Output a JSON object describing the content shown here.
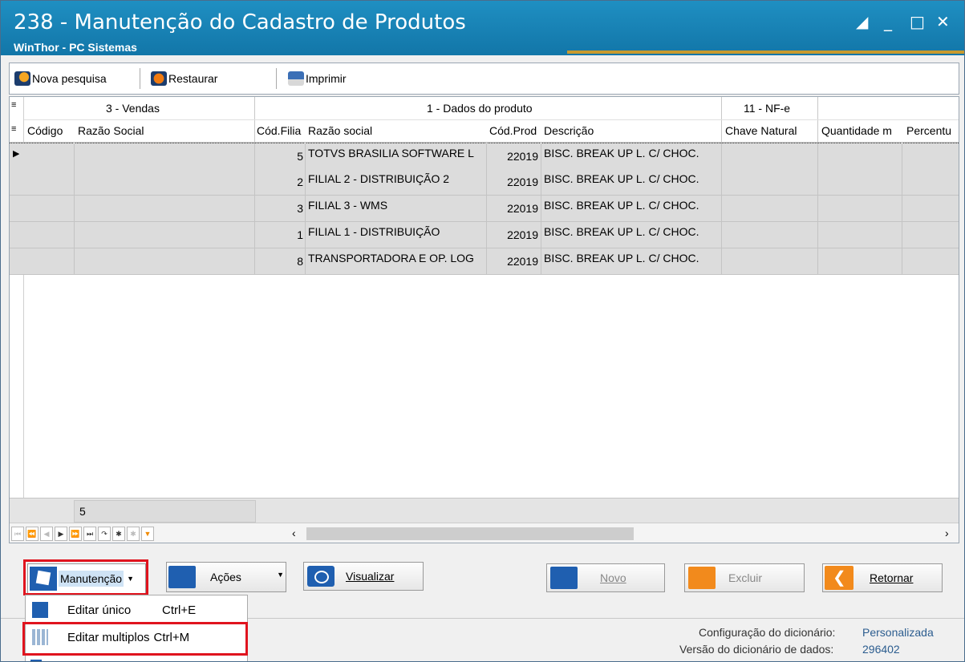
{
  "window": {
    "title": "238 - Manutenção do Cadastro de Produtos",
    "subtitle": "WinThor - PC Sistemas"
  },
  "toolbar": {
    "nova_pesquisa": "Nova pesquisa",
    "restaurar": "Restaurar",
    "imprimir": "Imprimir"
  },
  "grid": {
    "bands": {
      "vendas": "3 - Vendas",
      "dados_produto": "1 - Dados do produto",
      "nfe": "11 - NF-e"
    },
    "columns": {
      "codigo": "Código",
      "razao_social_vendas": "Razão Social",
      "cod_filial": "Cód.Filia",
      "razao_social": "Razão social",
      "cod_prod": "Cód.Prod",
      "descricao": "Descrição",
      "chave_natural": "Chave Natural",
      "quantidade": "Quantidade m",
      "percentual": "Percentu"
    },
    "rows": [
      {
        "cod_filial": "5",
        "razao_social": "TOTVS BRASILIA SOFTWARE L",
        "cod_prod": "22019",
        "descricao": "BISC. BREAK UP L. C/ CHOC."
      },
      {
        "cod_filial": "2",
        "razao_social": "FILIAL 2 - DISTRIBUIÇÃO 2",
        "cod_prod": "22019",
        "descricao": "BISC. BREAK UP L. C/ CHOC."
      },
      {
        "cod_filial": "3",
        "razao_social": "FILIAL 3 - WMS",
        "cod_prod": "22019",
        "descricao": "BISC. BREAK UP L. C/ CHOC."
      },
      {
        "cod_filial": "1",
        "razao_social": "FILIAL 1 - DISTRIBUIÇÃO",
        "cod_prod": "22019",
        "descricao": "BISC. BREAK UP L. C/ CHOC."
      },
      {
        "cod_filial": "8",
        "razao_social": "TRANSPORTADORA E OP. LOG",
        "cod_prod": "22019",
        "descricao": "BISC. BREAK UP L. C/ CHOC."
      }
    ],
    "footer_count": "5"
  },
  "buttons": {
    "manutencao": "Manutenção",
    "acoes": "Ações",
    "visualizar": "Visualizar",
    "novo": "Novo",
    "excluir": "Excluir",
    "retornar": "Retornar"
  },
  "menu": {
    "editar_unico": {
      "label": "Editar único",
      "shortcut": "Ctrl+E"
    },
    "editar_multiplos": {
      "label": "Editar multiplos",
      "shortcut": "Ctrl+M"
    }
  },
  "status": {
    "config_label": "Configuração do dicionário:",
    "config_value": "Personalizada",
    "versao_label": "Versão do dicionário de dados:",
    "versao_value": "296402"
  },
  "colors": {
    "titlebar": "#1f8fc2",
    "highlight_red": "#e0141e",
    "retornar_orange": "#f28a1c"
  }
}
